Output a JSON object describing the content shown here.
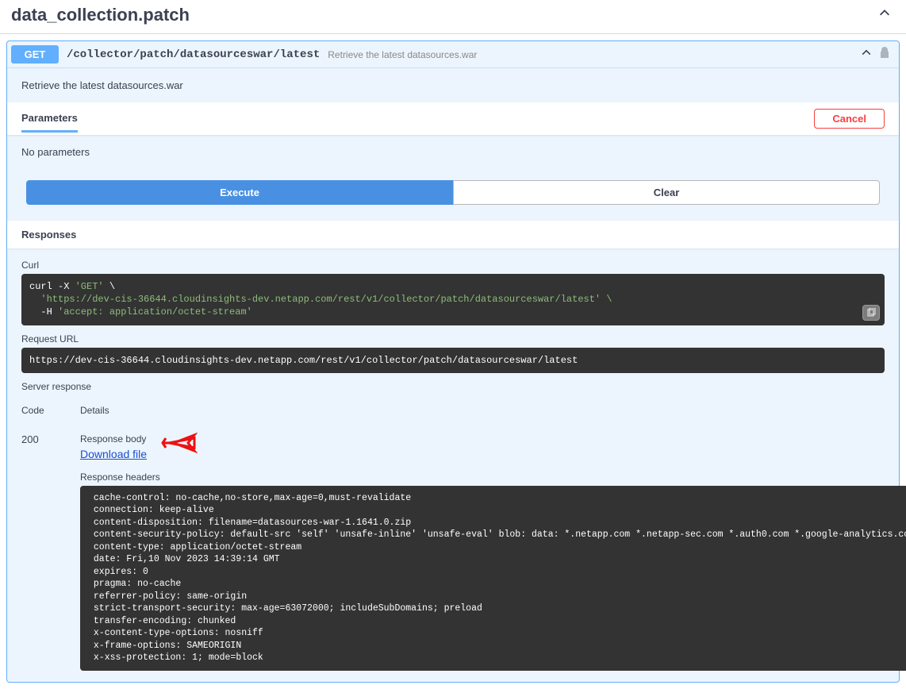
{
  "tag": {
    "name": "data_collection.patch"
  },
  "operation": {
    "method": "GET",
    "path": "/collector/patch/datasourceswar/latest",
    "summary": "Retrieve the latest datasources.war",
    "description": "Retrieve the latest datasources.war"
  },
  "labels": {
    "parameters": "Parameters",
    "cancel": "Cancel",
    "no_parameters": "No parameters",
    "execute": "Execute",
    "clear": "Clear",
    "responses": "Responses",
    "curl": "Curl",
    "request_url": "Request URL",
    "server_response": "Server response",
    "code": "Code",
    "details": "Details",
    "response_body": "Response body",
    "download_file": "Download file",
    "response_headers": "Response headers"
  },
  "curl": {
    "line1_a": "curl -X ",
    "line1_b": "'GET'",
    "line1_c": " \\",
    "line2": "  'https://dev-cis-36644.cloudinsights-dev.netapp.com/rest/v1/collector/patch/datasourceswar/latest' \\",
    "line3_a": "  -H ",
    "line3_b": "'accept: application/octet-stream'"
  },
  "request_url": "https://dev-cis-36644.cloudinsights-dev.netapp.com/rest/v1/collector/patch/datasourceswar/latest",
  "response": {
    "code": "200",
    "headers": " cache-control: no-cache,no-store,max-age=0,must-revalidate\n connection: keep-alive\n content-disposition: filename=datasources-war-1.1641.0.zip\n content-security-policy: default-src 'self' 'unsafe-inline' 'unsafe-eval' blob: data: *.netapp.com *.netapp-sec.com *.auth0.com *.google-analytics.com storage.googleapis.com *.spotinst.com\n content-type: application/octet-stream\n date: Fri,10 Nov 2023 14:39:14 GMT\n expires: 0\n pragma: no-cache\n referrer-policy: same-origin\n strict-transport-security: max-age=63072000; includeSubDomains; preload\n transfer-encoding: chunked\n x-content-type-options: nosniff\n x-frame-options: SAMEORIGIN\n x-xss-protection: 1; mode=block"
  }
}
